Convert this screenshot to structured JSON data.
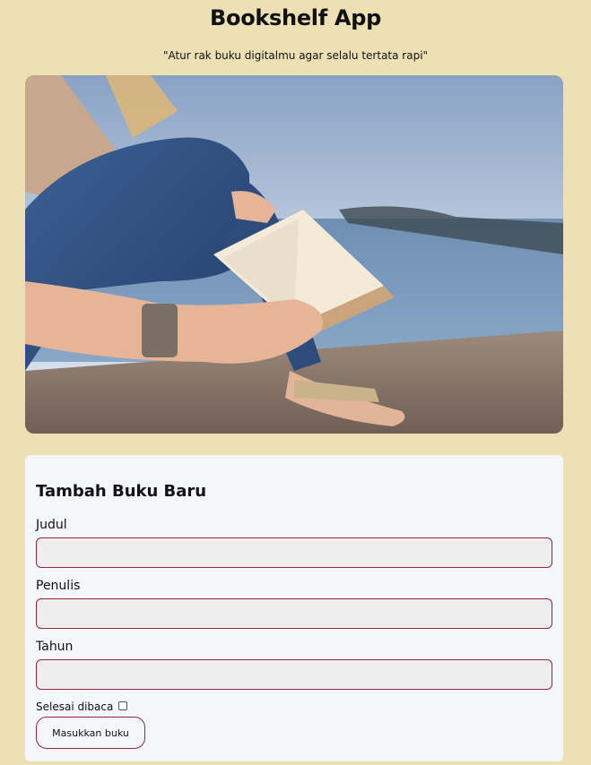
{
  "app": {
    "title": "Bookshelf App",
    "tagline": "\"Atur rak buku digitalmu agar selalu tertata rapi\""
  },
  "hero": {
    "image": "person-reading-book-by-lake"
  },
  "form": {
    "heading": "Tambah Buku Baru",
    "fields": [
      {
        "label": "Judul",
        "value": "",
        "placeholder": ""
      },
      {
        "label": "Penulis",
        "value": "",
        "placeholder": ""
      },
      {
        "label": "Tahun",
        "value": "",
        "placeholder": ""
      }
    ],
    "checkbox": {
      "label": "Selesai dibaca",
      "checked": false
    },
    "submit_label": "Masukkan buku"
  },
  "colors": {
    "background": "#ede0b4",
    "card": "#f5f6f9",
    "input_border": "#9b2335",
    "input_fill": "#efeeee"
  }
}
